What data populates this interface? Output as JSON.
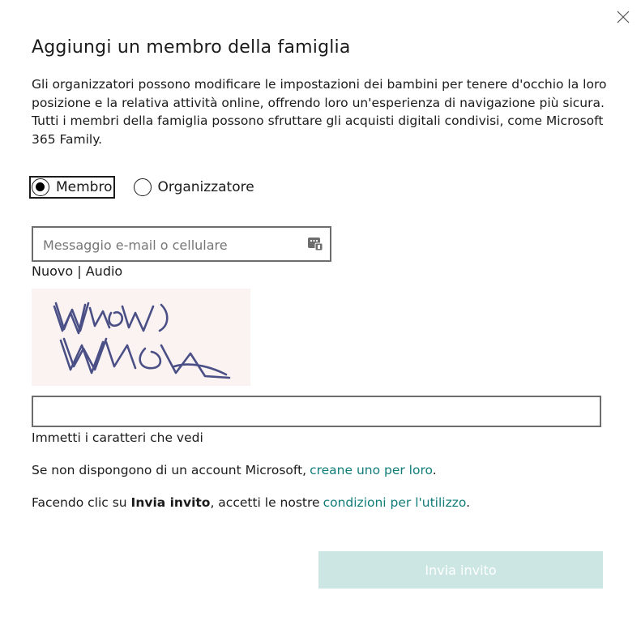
{
  "dialog": {
    "title": "Aggiungi un membro della famiglia",
    "description": "Gli organizzatori possono modificare le impostazioni dei bambini per tenere d'occhio la loro posizione e la relativa attività online, offrendo loro un'esperienza di navigazione più sicura. Tutti i membri della famiglia possono sfruttare gli acquisti digitali condivisi, come Microsoft 365 Family.",
    "close_icon": "close-icon"
  },
  "role": {
    "options": [
      {
        "label": "Membro",
        "selected": true
      },
      {
        "label": "Organizzatore",
        "selected": false
      }
    ]
  },
  "email": {
    "placeholder": "Messaggio e-mail o cellulare",
    "value": "",
    "icon": "keyboard-icon"
  },
  "captcha": {
    "new_label": "Nuovo",
    "separator": "|",
    "audio_label": "Audio",
    "hint": "Immetti i caratteri che vedi",
    "value": ""
  },
  "footer": {
    "no_account_text": "Se non dispongono di un account Microsoft,",
    "no_account_link": "creane uno per loro",
    "terms_prefix": "Facendo clic su",
    "terms_bold": "Invia invito",
    "terms_middle": ", accetti le nostre",
    "terms_link": "condizioni per l'utilizzo",
    "period": "."
  },
  "actions": {
    "submit_label": "Invia invito",
    "submit_enabled": false
  },
  "colors": {
    "link": "#107c78",
    "submit_disabled_bg": "#cbe6e3"
  }
}
